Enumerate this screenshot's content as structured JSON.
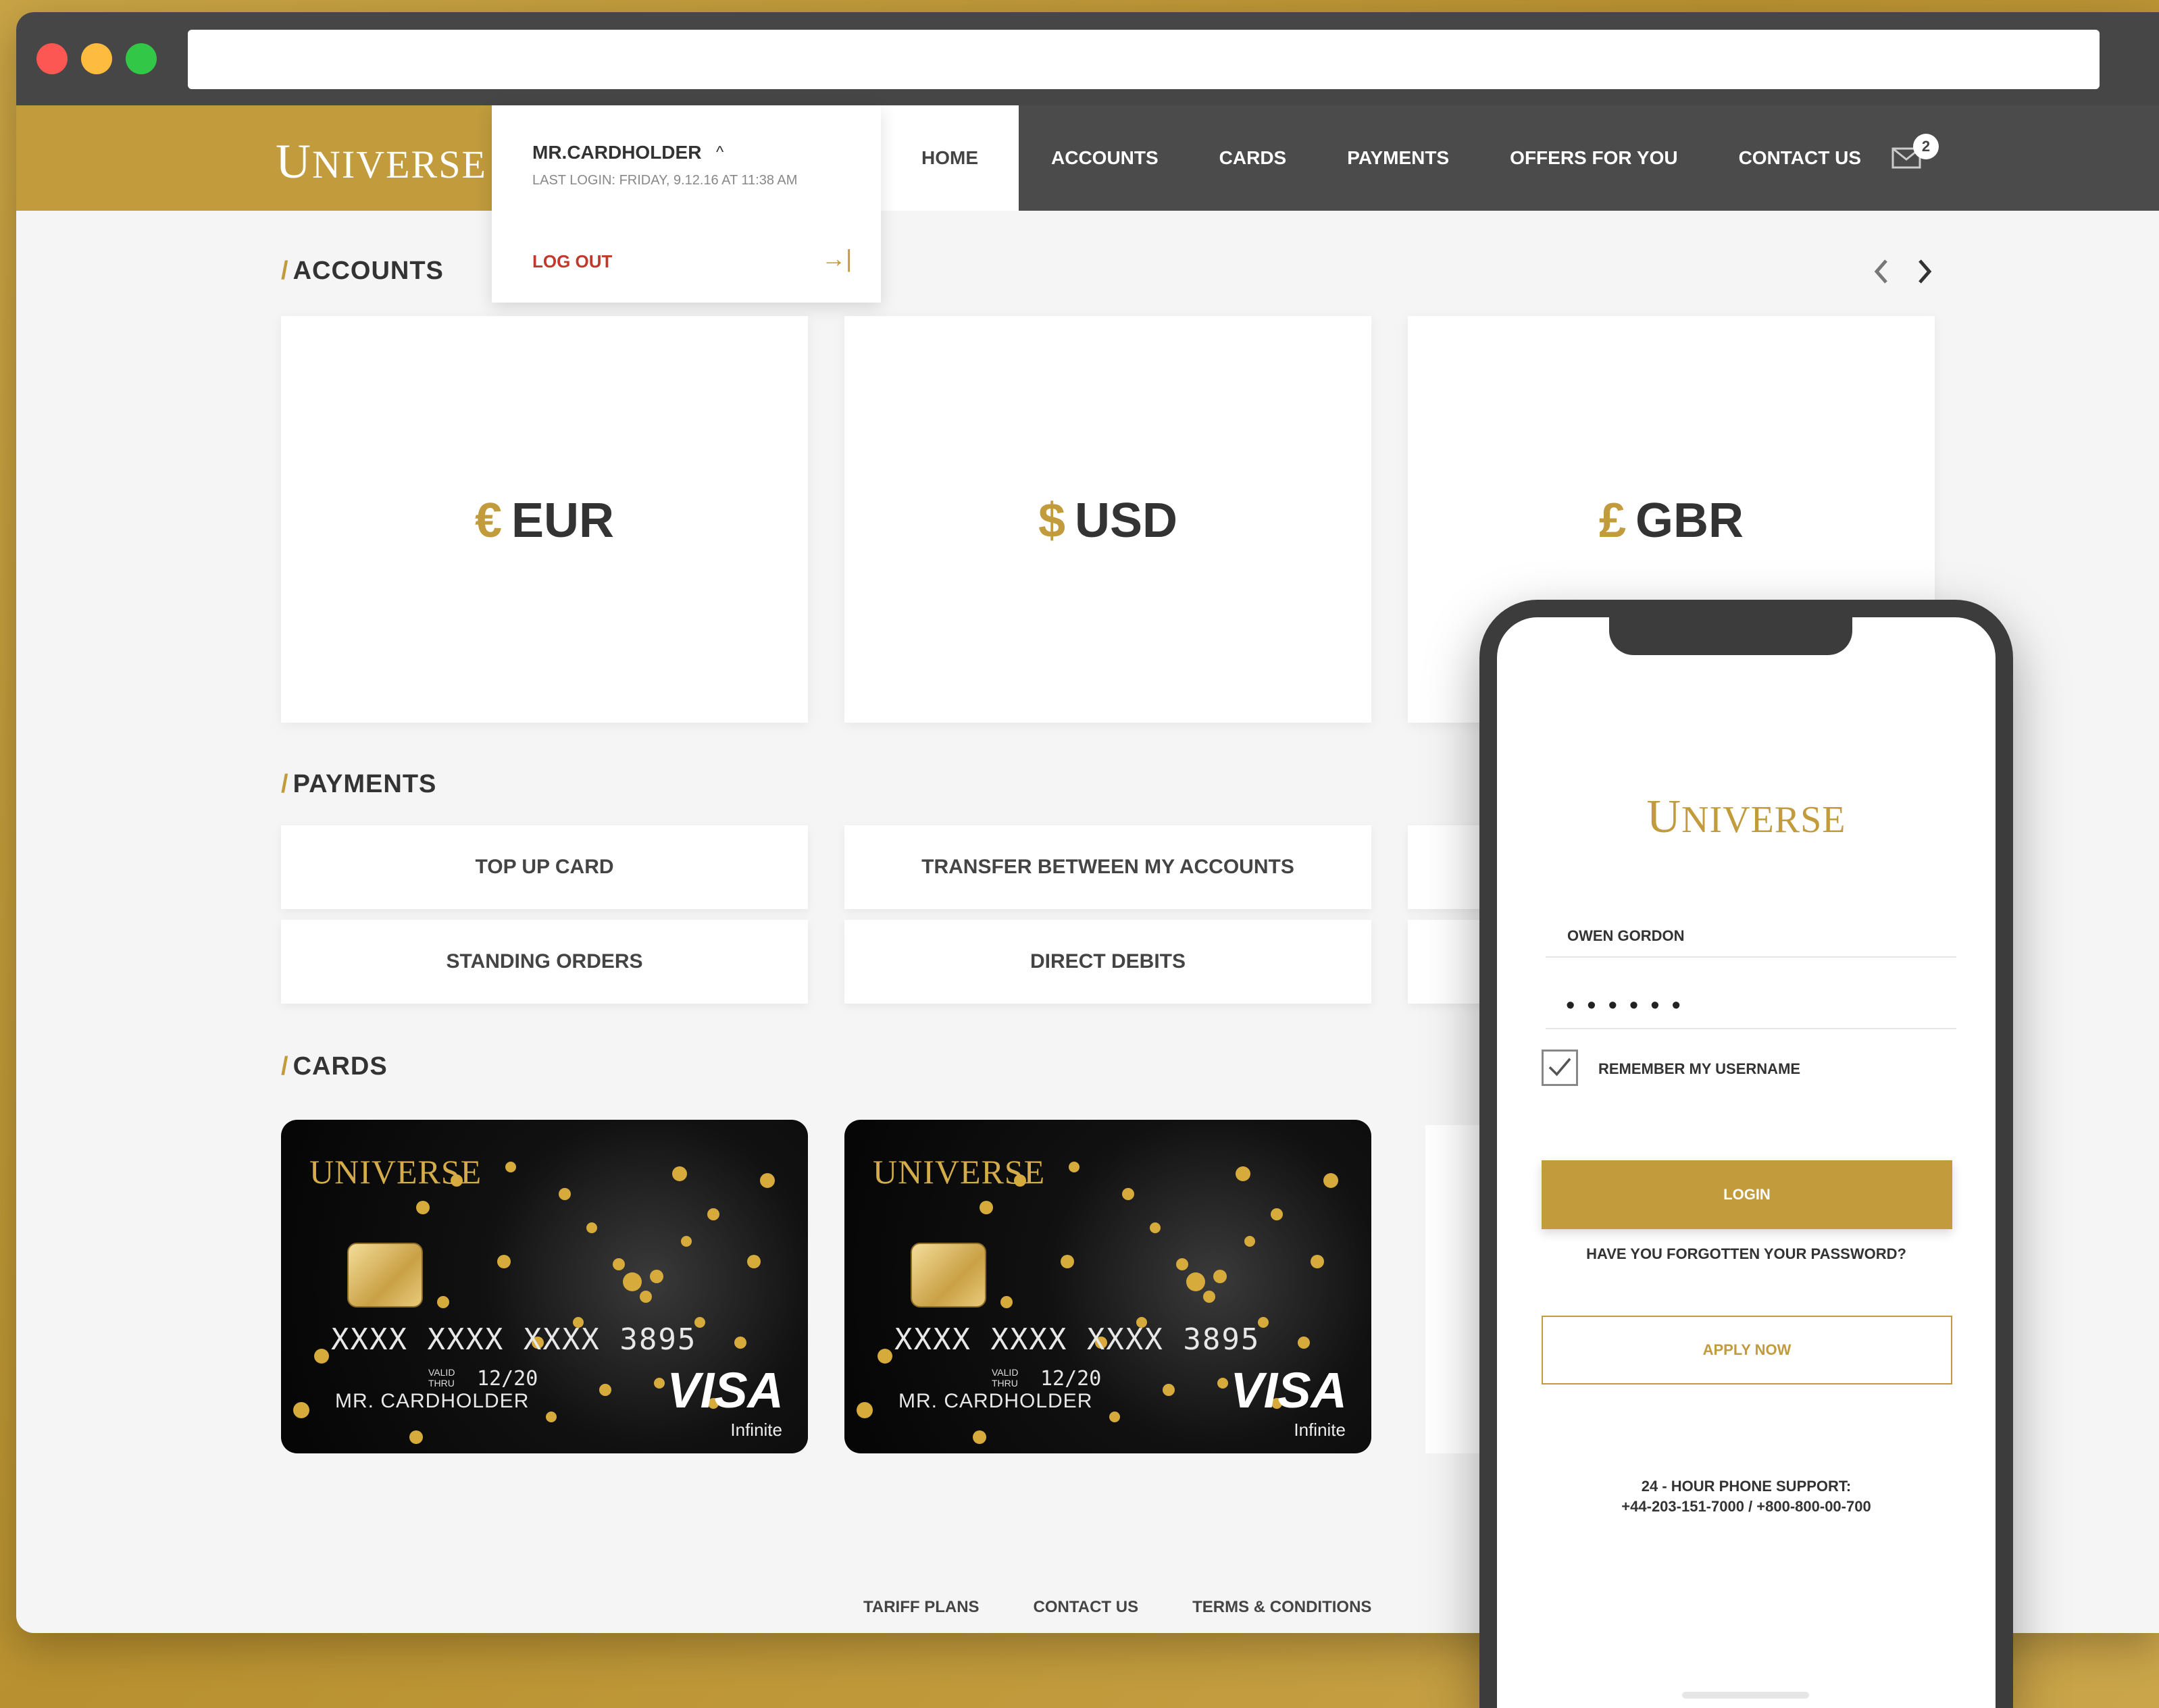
{
  "colors": {
    "gold": "#c19b3c",
    "dark": "#4b4b4b",
    "logout_red": "#c0392b"
  },
  "brand": {
    "name": "NIVERSE",
    "initial": "U"
  },
  "header": {
    "nav": [
      "ACCOUNTS",
      "CARDS",
      "PAYMENTS",
      "OFFERS FOR YOU",
      "CONTACT US"
    ],
    "home": "HOME",
    "mail_count": "2"
  },
  "user": {
    "name": "MR.CARDHOLDER",
    "chevron": "^",
    "last_login": "LAST LOGIN: FRIDAY, 9.12.16 AT 11:38 AM",
    "logout": "LOG OUT",
    "logout_icon": "→|"
  },
  "sections": {
    "accounts": "ACCOUNTS",
    "payments": "PAYMENTS",
    "cards": "CARDS",
    "slash": "/"
  },
  "accounts": [
    {
      "symbol": "€",
      "code": "EUR"
    },
    {
      "symbol": "$",
      "code": "USD"
    },
    {
      "symbol": "£",
      "code": "GBR"
    }
  ],
  "payments": {
    "top_up": "TOP UP CARD",
    "transfer": "TRANSFER BETWEEN MY ACCOUNTS",
    "standing": "STANDING ORDERS",
    "direct": "DIRECT DEBITS"
  },
  "cards": [
    {
      "number": "XXXX XXXX XXXX 3895",
      "valid": "VALID THRU",
      "expiry": "12/20",
      "holder": "MR. CARDHOLDER",
      "network": "VISA",
      "tier": "Infinite"
    },
    {
      "number": "XXXX XXXX XXXX 3895",
      "valid": "VALID THRU",
      "expiry": "12/20",
      "holder": "MR. CARDHOLDER",
      "network": "VISA",
      "tier": "Infinite"
    }
  ],
  "footer": [
    "TARIFF PLANS",
    "CONTACT US",
    "TERMS & CONDITIONS"
  ],
  "phone": {
    "username": "OWEN GORDON",
    "password_mask": "••••••",
    "remember": "REMEMBER MY USERNAME",
    "login": "LOGIN",
    "forgot": "HAVE YOU FORGOTTEN YOUR PASSWORD?",
    "apply": "APPLY NOW",
    "support_title": "24 - HOUR PHONE SUPPORT:",
    "support_numbers": "+44-203-151-7000 / +800-800-00-700"
  },
  "icons": {
    "prev": "chevron-left-icon",
    "next": "chevron-right-icon",
    "mail": "mail-icon",
    "check": "checkmark-icon"
  }
}
